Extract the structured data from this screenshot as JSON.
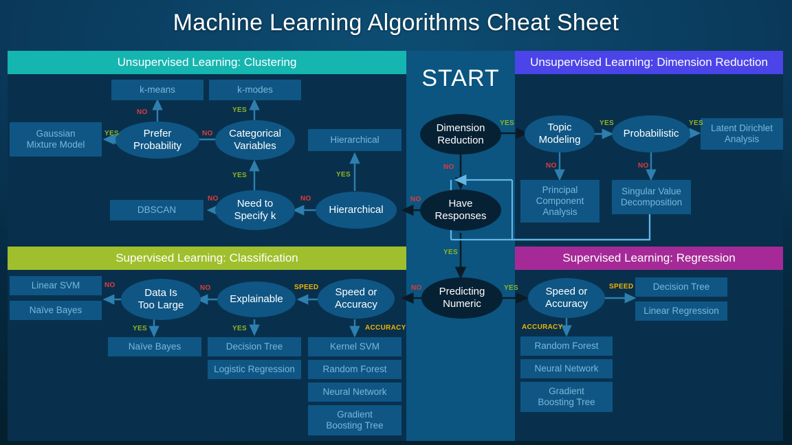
{
  "title": "Machine Learning Algorithms Cheat Sheet",
  "start_label": "START",
  "colors": {
    "clustering_header": "#15b5b0",
    "dimension_header": "#4b44e8",
    "classification_header": "#a0bf2c",
    "regression_header": "#a52a97",
    "yes": "#8fb522",
    "no": "#e03c3c",
    "speed_accuracy": "#f0b400",
    "panel": "#08304d",
    "center_column": "#0b5580",
    "node": "#0f5684",
    "node_dark": "#062134",
    "box_text": "#79b8dd"
  },
  "panels": {
    "clustering": {
      "header": "Unsupervised Learning: Clustering",
      "boxes": {
        "kmeans": "k-means",
        "kmodes": "k-modes",
        "gmm": "Gaussian\nMixture Model",
        "hierarchical_box": "Hierarchical",
        "dbscan": "DBSCAN"
      },
      "decisions": {
        "prefer_probability": "Prefer\nProbability",
        "categorical_variables": "Categorical\nVariables",
        "need_specify_k": "Need to\nSpecify k",
        "hierarchical": "Hierarchical"
      },
      "edges": {
        "prefer_prob_no": "NO",
        "categorical_yes": "YES",
        "prefer_prob_yes": "YES",
        "categorical_no": "NO",
        "need_k_yes": "YES",
        "need_k_no": "NO",
        "hierarchical_yes": "YES",
        "hierarchical_no": "NO"
      }
    },
    "dimension_reduction": {
      "header": "Unsupervised Learning: Dimension Reduction",
      "boxes": {
        "lda": "Latent Dirichlet\nAnalysis",
        "pca": "Principal\nComponent\nAnalysis",
        "svd": "Singular Value\nDecomposition"
      },
      "decisions": {
        "topic_modeling": "Topic\nModeling",
        "probabilistic": "Probabilistic"
      },
      "edges": {
        "topic_yes": "YES",
        "topic_no": "NO",
        "prob_yes": "YES",
        "prob_no": "NO"
      }
    },
    "classification": {
      "header": "Supervised Learning: Classification",
      "boxes": {
        "linear_svm": "Linear SVM",
        "naive_bayes_left": "Naïve Bayes",
        "naive_bayes_mid": "Naïve Bayes",
        "decision_tree": "Decision Tree",
        "logistic_regression": "Logistic Regression",
        "kernel_svm": "Kernel SVM",
        "random_forest": "Random Forest",
        "neural_network": "Neural Network",
        "gradient_boosting_tree": "Gradient\nBoosting Tree"
      },
      "decisions": {
        "data_too_large": "Data Is\nToo Large",
        "explainable": "Explainable",
        "speed_or_accuracy": "Speed or\nAccuracy"
      },
      "edges": {
        "data_large_no": "NO",
        "data_large_yes": "YES",
        "explainable_no": "NO",
        "explainable_yes": "YES",
        "speed": "SPEED",
        "accuracy": "ACCURACY"
      }
    },
    "regression": {
      "header": "Supervised Learning: Regression",
      "boxes": {
        "decision_tree": "Decision Tree",
        "linear_regression": "Linear Regression",
        "random_forest": "Random Forest",
        "neural_network": "Neural Network",
        "gradient_boosting_tree": "Gradient\nBoosting Tree"
      },
      "decisions": {
        "speed_or_accuracy": "Speed or\nAccuracy"
      },
      "edges": {
        "speed": "SPEED",
        "accuracy": "ACCURACY"
      }
    }
  },
  "center": {
    "decisions": {
      "dimension_reduction": "Dimension\nReduction",
      "have_responses": "Have\nResponses",
      "predicting_numeric": "Predicting\nNumeric"
    },
    "edges": {
      "dim_yes": "YES",
      "dim_no": "NO",
      "resp_no": "NO",
      "resp_yes": "YES",
      "pred_no": "NO",
      "pred_yes": "YES"
    }
  }
}
